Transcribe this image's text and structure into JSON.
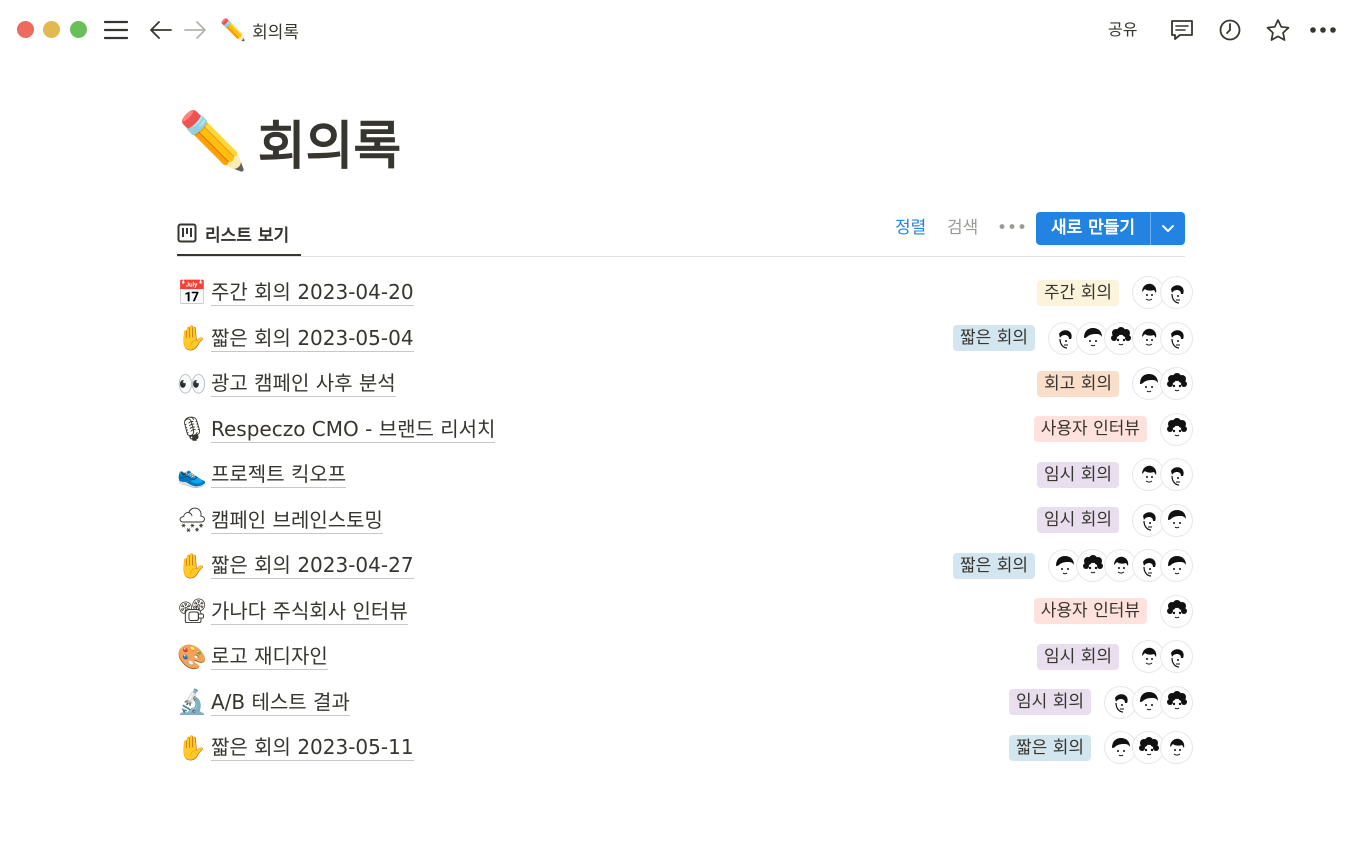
{
  "topbar": {
    "breadcrumb_emoji": "✏️",
    "breadcrumb_title": "회의록",
    "share_label": "공유"
  },
  "page": {
    "emoji": "✏️",
    "title": "회의록"
  },
  "view": {
    "tab_label": "리스트 보기",
    "sort_label": "정렬",
    "search_label": "검색",
    "more_label": "•••",
    "new_label": "새로 만들기"
  },
  "colors": {
    "accent": "#2383e2",
    "tag_yellow": "#fbf3db",
    "tag_blue": "#d3e5ef",
    "tag_orange": "#fadec9",
    "tag_red": "#ffe2dd",
    "tag_purple": "#e8deee"
  },
  "rows": [
    {
      "emoji": "📅",
      "title": "주간 회의 2023-04-20",
      "tag": "주간 회의",
      "tag_color": "#fbf3db",
      "avatars": 2
    },
    {
      "emoji": "✋",
      "title": "짧은 회의 2023-05-04",
      "tag": "짧은 회의",
      "tag_color": "#d3e5ef",
      "avatars": 5
    },
    {
      "emoji": "👀",
      "title": "광고 캠페인 사후 분석",
      "tag": "회고 회의",
      "tag_color": "#fadec9",
      "avatars": 2
    },
    {
      "emoji": "🎙",
      "title": "Respeczo CMO - 브랜드 리서치",
      "tag": "사용자 인터뷰",
      "tag_color": "#ffe2dd",
      "avatars": 1
    },
    {
      "emoji": "👟",
      "title": "프로젝트 킥오프",
      "tag": "임시 회의",
      "tag_color": "#e8deee",
      "avatars": 2
    },
    {
      "emoji": "🌨",
      "title": "캠페인 브레인스토밍",
      "tag": "임시 회의",
      "tag_color": "#e8deee",
      "avatars": 2
    },
    {
      "emoji": "✋",
      "title": "짧은 회의 2023-04-27",
      "tag": "짧은 회의",
      "tag_color": "#d3e5ef",
      "avatars": 5
    },
    {
      "emoji": "📽",
      "title": "가나다 주식회사 인터뷰",
      "tag": "사용자 인터뷰",
      "tag_color": "#ffe2dd",
      "avatars": 1
    },
    {
      "emoji": "🎨",
      "title": "로고 재디자인",
      "tag": "임시 회의",
      "tag_color": "#e8deee",
      "avatars": 2
    },
    {
      "emoji": "🔬",
      "title": "A/B 테스트 결과",
      "tag": "임시 회의",
      "tag_color": "#e8deee",
      "avatars": 3
    },
    {
      "emoji": "✋",
      "title": "짧은 회의 2023-05-11",
      "tag": "짧은 회의",
      "tag_color": "#d3e5ef",
      "avatars": 3
    }
  ]
}
